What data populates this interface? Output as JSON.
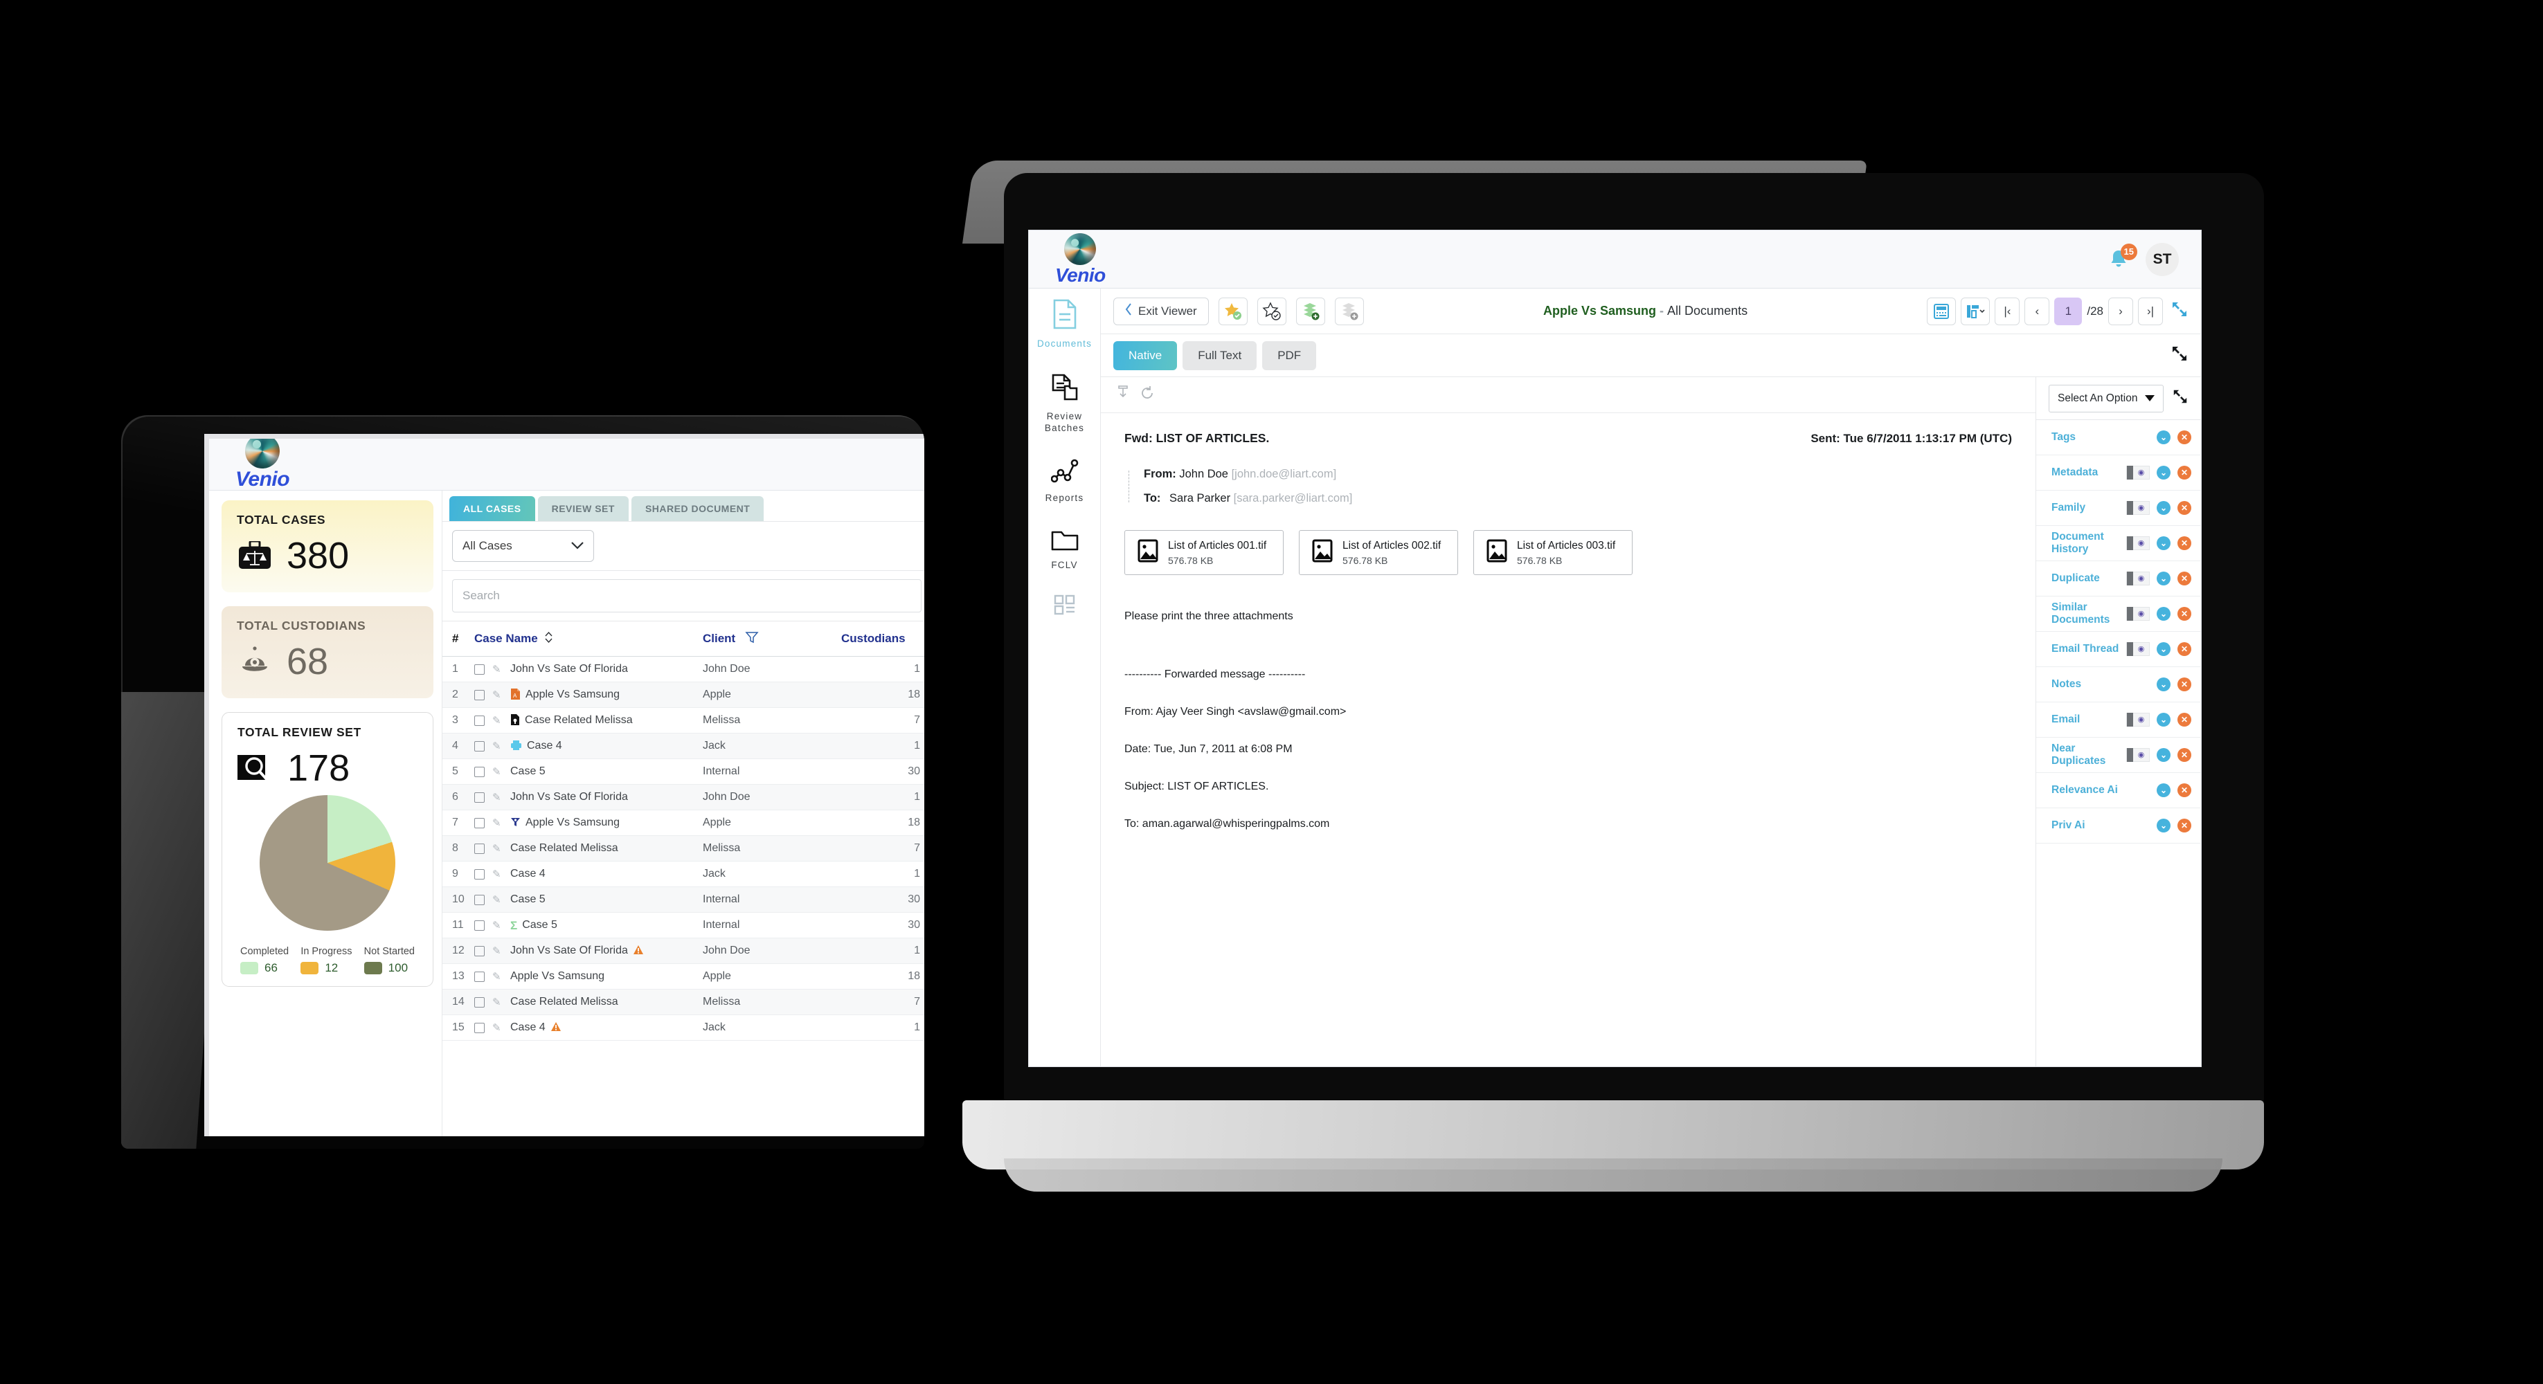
{
  "brand": {
    "name": "Venio"
  },
  "tablet": {
    "kpis": [
      {
        "title": "TOTAL CASES",
        "value": "380",
        "icon": "briefcase-scales-icon"
      },
      {
        "title": "TOTAL CUSTODIANS",
        "value": "68",
        "icon": "custodian-helmet-icon"
      },
      {
        "title": "TOTAL REVIEW SET",
        "value": "178",
        "icon": "magnifier-icon"
      }
    ],
    "tabs": [
      {
        "label": "ALL CASES",
        "active": true
      },
      {
        "label": "REVIEW SET",
        "active": false
      },
      {
        "label": "SHARED DOCUMENT",
        "active": false
      }
    ],
    "case_filter": {
      "value": "All Cases"
    },
    "search": {
      "placeholder": "Search",
      "value": ""
    },
    "columns": {
      "num": "#",
      "case_name": "Case Name",
      "client": "Client",
      "custodians": "Custodians"
    },
    "rows": [
      {
        "n": "1",
        "name": "John Vs Sate Of Florida",
        "client": "John Doe",
        "cust": "1",
        "icon": "",
        "warn": false
      },
      {
        "n": "2",
        "name": "Apple Vs Samsung",
        "client": "Apple",
        "cust": "18",
        "icon": "pdf-icon",
        "warn": false
      },
      {
        "n": "3",
        "name": "Case Related Melissa",
        "client": "Melissa",
        "cust": "7",
        "icon": "lock-doc-icon",
        "warn": false
      },
      {
        "n": "4",
        "name": "Case 4",
        "client": "Jack",
        "cust": "1",
        "icon": "printer-icon",
        "warn": false
      },
      {
        "n": "5",
        "name": "Case 5",
        "client": "Internal",
        "cust": "30",
        "icon": "",
        "warn": false
      },
      {
        "n": "6",
        "name": "John Vs Sate Of Florida",
        "client": "John Doe",
        "cust": "1",
        "icon": "",
        "warn": false
      },
      {
        "n": "7",
        "name": "Apple Vs Samsung",
        "client": "Apple",
        "cust": "18",
        "icon": "funnel-icon",
        "warn": false
      },
      {
        "n": "8",
        "name": "Case Related Melissa",
        "client": "Melissa",
        "cust": "7",
        "icon": "",
        "warn": false
      },
      {
        "n": "9",
        "name": "Case 4",
        "client": "Jack",
        "cust": "1",
        "icon": "",
        "warn": false
      },
      {
        "n": "10",
        "name": "Case 5",
        "client": "Internal",
        "cust": "30",
        "icon": "",
        "warn": false
      },
      {
        "n": "11",
        "name": "Case 5",
        "client": "Internal",
        "cust": "30",
        "icon": "sigma-icon",
        "warn": false
      },
      {
        "n": "12",
        "name": "John Vs Sate Of Florida",
        "client": "John Doe",
        "cust": "1",
        "icon": "",
        "warn": true
      },
      {
        "n": "13",
        "name": "Apple Vs Samsung",
        "client": "Apple",
        "cust": "18",
        "icon": "",
        "warn": false
      },
      {
        "n": "14",
        "name": "Case Related Melissa",
        "client": "Melissa",
        "cust": "7",
        "icon": "",
        "warn": false
      },
      {
        "n": "15",
        "name": "Case 4",
        "client": "Jack",
        "cust": "1",
        "icon": "",
        "warn": true
      }
    ]
  },
  "chart_data": {
    "type": "pie",
    "title": "TOTAL REVIEW SET",
    "total": 178,
    "categories": [
      "Completed",
      "In Progress",
      "Not Started"
    ],
    "values": [
      66,
      12,
      100
    ],
    "colors": [
      "#c6eec5",
      "#f0b43c",
      "#a49a86"
    ],
    "legend_position": "bottom"
  },
  "laptop": {
    "header": {
      "notifications": "15",
      "avatar_initials": "ST"
    },
    "rail": [
      {
        "label": "Documents",
        "icon": "document-icon",
        "active": true
      },
      {
        "label": "Review Batches",
        "icon": "review-batch-icon",
        "active": false
      },
      {
        "label": "Reports",
        "icon": "reports-graph-icon",
        "active": false
      },
      {
        "label": "FCLV",
        "icon": "folder-icon",
        "active": false
      },
      {
        "label": "",
        "icon": "grid-list-icon",
        "active": false
      }
    ],
    "toolbar": {
      "exit_label": "Exit Viewer",
      "icons": [
        "star-filled-check-icon",
        "star-outline-check-icon",
        "stack-green-add-icon",
        "stack-grey-add-icon"
      ],
      "doc_title_case": "Apple Vs Samsung",
      "doc_title_sep": "-",
      "doc_title_scope": "All Documents",
      "pager": {
        "keyboard_icon": "keyboard-icon",
        "layout_icon": "layout-icon",
        "first": "|‹",
        "prev": "‹",
        "current": "1",
        "total": "/28",
        "next": "›",
        "last": "›|",
        "expand_icon": "expand-icon"
      }
    },
    "view_tabs": [
      {
        "label": "Native",
        "active": true
      },
      {
        "label": "Full Text",
        "active": false
      },
      {
        "label": "PDF",
        "active": false
      }
    ],
    "native_tools": [
      "download-icon",
      "refresh-icon"
    ],
    "email": {
      "subject": "Fwd: LIST OF ARTICLES.",
      "sent": "Sent: Tue 6/7/2011 1:13:17 PM (UTC)",
      "from_label": "From:",
      "from_name": "John Doe",
      "from_email": "[john.doe@liart.com]",
      "to_label": "To:",
      "to_name": "Sara Parker",
      "to_email": "[sara.parker@liart.com]",
      "attachments": [
        {
          "name": "List of Articles 001.tif",
          "size": "576.78 KB",
          "icon": "image-file-icon"
        },
        {
          "name": "List of Articles 002.tif",
          "size": "576.78 KB",
          "icon": "image-file-icon"
        },
        {
          "name": "List of Articles 003.tif",
          "size": "576.78 KB",
          "icon": "image-file-icon"
        }
      ],
      "body": [
        "Please print the three attachments",
        "---------- Forwarded message ----------",
        "From: Ajay Veer Singh <avslaw@gmail.com>",
        "Date: Tue, Jun 7, 2011 at 6:08 PM",
        "Subject: LIST OF ARTICLES.",
        "To: aman.agarwal@whisperingpalms.com"
      ]
    },
    "sidebar": {
      "option_select": {
        "value": "Select An Option"
      },
      "expand_icon": "expand-icon",
      "items": [
        {
          "label": "Tags",
          "has_toggle": false
        },
        {
          "label": "Metadata",
          "has_toggle": true
        },
        {
          "label": "Family",
          "has_toggle": true
        },
        {
          "label": "Document History",
          "has_toggle": true
        },
        {
          "label": "Duplicate",
          "has_toggle": true
        },
        {
          "label": "Similar Documents",
          "has_toggle": true
        },
        {
          "label": "Email Thread",
          "has_toggle": true
        },
        {
          "label": "Notes",
          "has_toggle": false
        },
        {
          "label": "Email",
          "has_toggle": true
        },
        {
          "label": "Near Duplicates",
          "has_toggle": true
        },
        {
          "label": "Relevance Ai",
          "has_toggle": false
        },
        {
          "label": "Priv Ai",
          "has_toggle": false
        }
      ]
    }
  }
}
